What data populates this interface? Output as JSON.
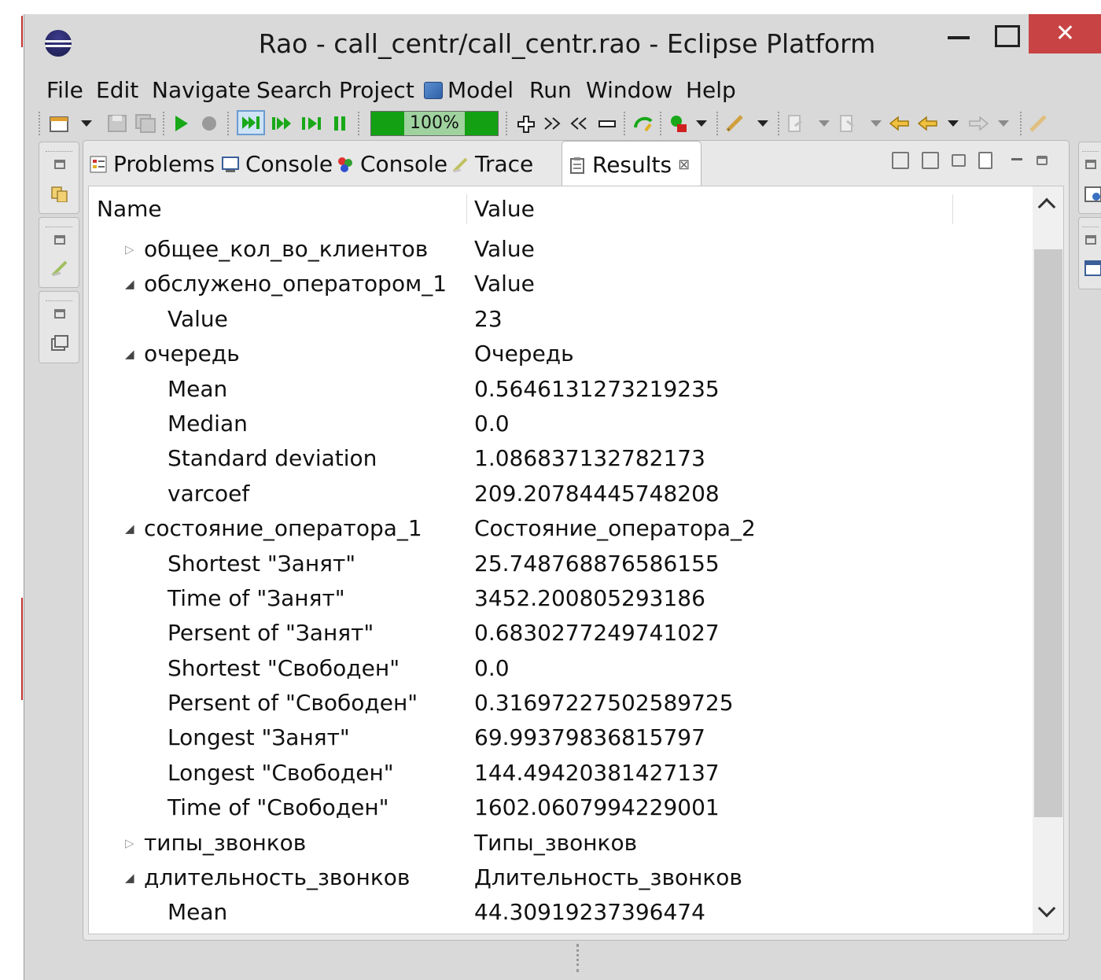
{
  "window": {
    "title": "Rao - call_centr/call_centr.rao - Eclipse Platform",
    "close_glyph": "✕"
  },
  "menu": {
    "items": [
      "File",
      "Edit",
      "Navigate",
      "Search",
      "Project",
      "Model",
      "Run",
      "Window",
      "Help"
    ]
  },
  "toolbar": {
    "simulation_speed": "100%"
  },
  "tabs": [
    {
      "label": "Problems",
      "icon": "problems-icon",
      "active": false
    },
    {
      "label": "Console",
      "icon": "console-icon",
      "active": false
    },
    {
      "label": "Console",
      "icon": "rao-console-icon",
      "active": false
    },
    {
      "label": "Trace",
      "icon": "trace-icon",
      "active": false
    },
    {
      "label": "Results",
      "icon": "results-icon",
      "active": true,
      "close_glyph": "⊠"
    }
  ],
  "results": {
    "columns": [
      "Name",
      "Value"
    ],
    "rows": [
      {
        "name": "общее_кол_во_клиентов",
        "value": "Value",
        "level": 0,
        "state": "collapsed"
      },
      {
        "name": "обслужено_оператором_1",
        "value": "Value",
        "level": 0,
        "state": "expanded"
      },
      {
        "name": "Value",
        "value": "23",
        "level": 1,
        "state": "leaf"
      },
      {
        "name": "очередь",
        "value": "Очередь",
        "level": 0,
        "state": "expanded"
      },
      {
        "name": "Mean",
        "value": "0.5646131273219235",
        "level": 1,
        "state": "leaf"
      },
      {
        "name": "Median",
        "value": "0.0",
        "level": 1,
        "state": "leaf"
      },
      {
        "name": "Standard deviation",
        "value": "1.086837132782173",
        "level": 1,
        "state": "leaf"
      },
      {
        "name": "varcoef",
        "value": "209.20784445748208",
        "level": 1,
        "state": "leaf"
      },
      {
        "name": "состояние_оператора_1",
        "value": "Состояние_оператора_2",
        "level": 0,
        "state": "expanded"
      },
      {
        "name": "Shortest \"Занят\"",
        "value": "25.748768876586155",
        "level": 1,
        "state": "leaf"
      },
      {
        "name": "Time of \"Занят\"",
        "value": "3452.200805293186",
        "level": 1,
        "state": "leaf"
      },
      {
        "name": "Persent of \"Занят\"",
        "value": "0.6830277249741027",
        "level": 1,
        "state": "leaf"
      },
      {
        "name": "Shortest \"Свободен\"",
        "value": "0.0",
        "level": 1,
        "state": "leaf"
      },
      {
        "name": "Persent of \"Свободен\"",
        "value": "0.31697227502589725",
        "level": 1,
        "state": "leaf"
      },
      {
        "name": "Longest \"Занят\"",
        "value": "69.99379836815797",
        "level": 1,
        "state": "leaf"
      },
      {
        "name": "Longest \"Свободен\"",
        "value": "144.49420381427137",
        "level": 1,
        "state": "leaf"
      },
      {
        "name": "Time of \"Свободен\"",
        "value": "1602.0607994229001",
        "level": 1,
        "state": "leaf"
      },
      {
        "name": "типы_звонков",
        "value": "Типы_звонков",
        "level": 0,
        "state": "collapsed"
      },
      {
        "name": "длительность_звонков",
        "value": "Длительность_звонков",
        "level": 0,
        "state": "expanded"
      },
      {
        "name": "Mean",
        "value": "44.30919237396474",
        "level": 1,
        "state": "leaf"
      }
    ]
  },
  "colors": {
    "chrome": "#d9d9d9",
    "close_button": "#c84444",
    "progress_green": "#13a013"
  }
}
